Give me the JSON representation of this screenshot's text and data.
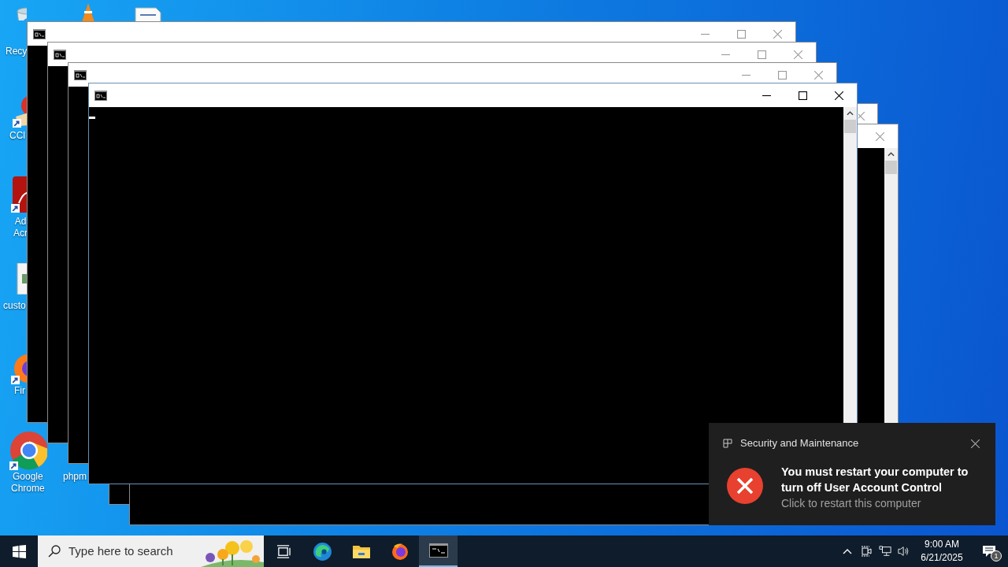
{
  "desktop_icons": [
    {
      "kind": "recycle-bin",
      "lines": [
        "Recy"
      ]
    },
    {
      "kind": "cone"
    },
    {
      "kind": "document"
    },
    {
      "kind": "cleaner",
      "shortcut": true,
      "lines": [
        "CCl"
      ]
    },
    {
      "kind": "pdf",
      "shortcut": true,
      "lines": [
        "Ad",
        "Acr"
      ]
    },
    {
      "kind": "image",
      "lines": [
        "custo"
      ]
    },
    {
      "kind": "firefox",
      "shortcut": true,
      "lines": [
        "Fir"
      ]
    },
    {
      "kind": "chrome",
      "shortcut": true,
      "lines": [
        "Google",
        "Chrome"
      ]
    },
    {
      "kind": "php",
      "lines": [
        "phpm"
      ]
    }
  ],
  "windows": [
    {
      "active": false,
      "show_icon": true,
      "controls": [
        {
          "kind": "minimize"
        },
        {
          "kind": "maximize"
        },
        {
          "kind": "close"
        }
      ]
    },
    {
      "active": false,
      "show_icon": true,
      "controls": [
        {
          "kind": "minimize"
        },
        {
          "kind": "maximize"
        },
        {
          "kind": "close"
        }
      ]
    },
    {
      "active": false,
      "show_icon": true,
      "controls": [
        {
          "kind": "minimize"
        },
        {
          "kind": "maximize"
        },
        {
          "kind": "close"
        }
      ]
    },
    {
      "active": true,
      "show_icon": true,
      "controls": [
        {
          "kind": "minimize"
        },
        {
          "kind": "maximize"
        },
        {
          "kind": "close"
        }
      ],
      "scrollbar": true,
      "cursor": true
    },
    {
      "active": false,
      "controls": [
        {
          "kind": "close"
        }
      ]
    },
    {
      "active": false,
      "controls": [
        {
          "kind": "close"
        }
      ],
      "scrollbar": true
    }
  ],
  "notification": {
    "source": "Security and Maintenance",
    "title": "You must restart your computer to turn off User Account Control",
    "subtitle": "Click to restart this computer"
  },
  "taskbar": {
    "search": {
      "placeholder": "Type here to search"
    },
    "apps": [
      {
        "kind": "task-view",
        "active": false
      },
      {
        "kind": "edge",
        "active": false
      },
      {
        "kind": "folder",
        "active": false
      },
      {
        "kind": "firefox",
        "active": false
      },
      {
        "kind": "terminal",
        "active": true
      }
    ],
    "tray": [
      {
        "kind": "chevron"
      },
      {
        "kind": "meet"
      },
      {
        "kind": "network"
      },
      {
        "kind": "volume"
      }
    ],
    "clock": {
      "time": "9:00 AM",
      "date": "6/21/2025"
    },
    "action_center": {
      "badge": "1"
    }
  }
}
